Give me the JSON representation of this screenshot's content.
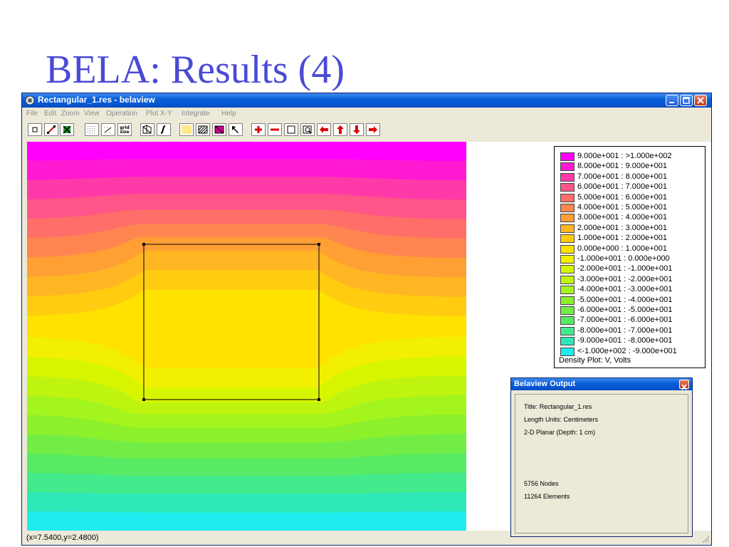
{
  "slide": {
    "title": "BELA: Results (4)"
  },
  "window": {
    "title": "Rectangular_1.res - belaview",
    "menu": [
      "File",
      "Edit",
      "Zoom",
      "View",
      "Operation",
      "Plot X-Y",
      "Integrate",
      "Help"
    ]
  },
  "toolbar": {
    "grid_size_label_1": "grid",
    "grid_size_label_2": "size",
    "icons": [
      "node-mode-icon",
      "segment-mode-icon",
      "block-mode-icon",
      "show-grid-icon",
      "snap-grid-icon",
      "grid-size-icon",
      "show-mesh-icon",
      "contour-plot-icon",
      "toggle-labels-icon",
      "hatch-icon",
      "density-plot-icon",
      "pointer-icon",
      "zoom-in-icon",
      "zoom-out-icon",
      "zoom-natural-icon",
      "zoom-window-icon",
      "pan-left-icon",
      "pan-up-icon",
      "pan-down-icon",
      "pan-right-icon"
    ]
  },
  "legend": {
    "entries": [
      {
        "label": "9.000e+001 : >1.000e+002",
        "color": "#ff00ff"
      },
      {
        "label": "8.000e+001 : 9.000e+001",
        "color": "#ff1ad2"
      },
      {
        "label": "7.000e+001 : 8.000e+001",
        "color": "#ff3aa8"
      },
      {
        "label": "6.000e+001 : 7.000e+001",
        "color": "#ff5588"
      },
      {
        "label": "5.000e+001 : 6.000e+001",
        "color": "#ff6e68"
      },
      {
        "label": "4.000e+001 : 5.000e+001",
        "color": "#ff8650"
      },
      {
        "label": "3.000e+001 : 4.000e+001",
        "color": "#ff9f34"
      },
      {
        "label": "2.000e+001 : 3.000e+001",
        "color": "#ffb622"
      },
      {
        "label": "1.000e+001 : 2.000e+001",
        "color": "#ffcc10"
      },
      {
        "label": "0.000e+000 : 1.000e+001",
        "color": "#ffe200"
      },
      {
        "label": "-1.000e+001 : 0.000e+000",
        "color": "#f2f000"
      },
      {
        "label": "-2.000e+001 : -1.000e+001",
        "color": "#d8f500"
      },
      {
        "label": "-3.000e+001 : -2.000e+001",
        "color": "#bef410"
      },
      {
        "label": "-4.000e+001 : -3.000e+001",
        "color": "#a4f41e"
      },
      {
        "label": "-5.000e+001 : -4.000e+001",
        "color": "#8cf02c"
      },
      {
        "label": "-6.000e+001 : -5.000e+001",
        "color": "#72ed46"
      },
      {
        "label": "-7.000e+001 : -6.000e+001",
        "color": "#58ea64"
      },
      {
        "label": "-8.000e+001 : -7.000e+001",
        "color": "#42ea8c"
      },
      {
        "label": "-9.000e+001 : -8.000e+001",
        "color": "#2ee8b8"
      },
      {
        "label": "<-1.000e+002 : -9.000e+001",
        "color": "#1eecee"
      }
    ],
    "caption": "Density Plot: V, Volts"
  },
  "output": {
    "title": "Belaview Output",
    "lines": [
      "Title: Rectangular_1.res",
      "Length Units: Centimeters",
      "2-D Planar (Depth: 1 cm)",
      "",
      "",
      "",
      "5756 Nodes",
      "11264 Elements"
    ]
  },
  "status": {
    "coords": "(x=7.5400,y=2.4800)"
  }
}
